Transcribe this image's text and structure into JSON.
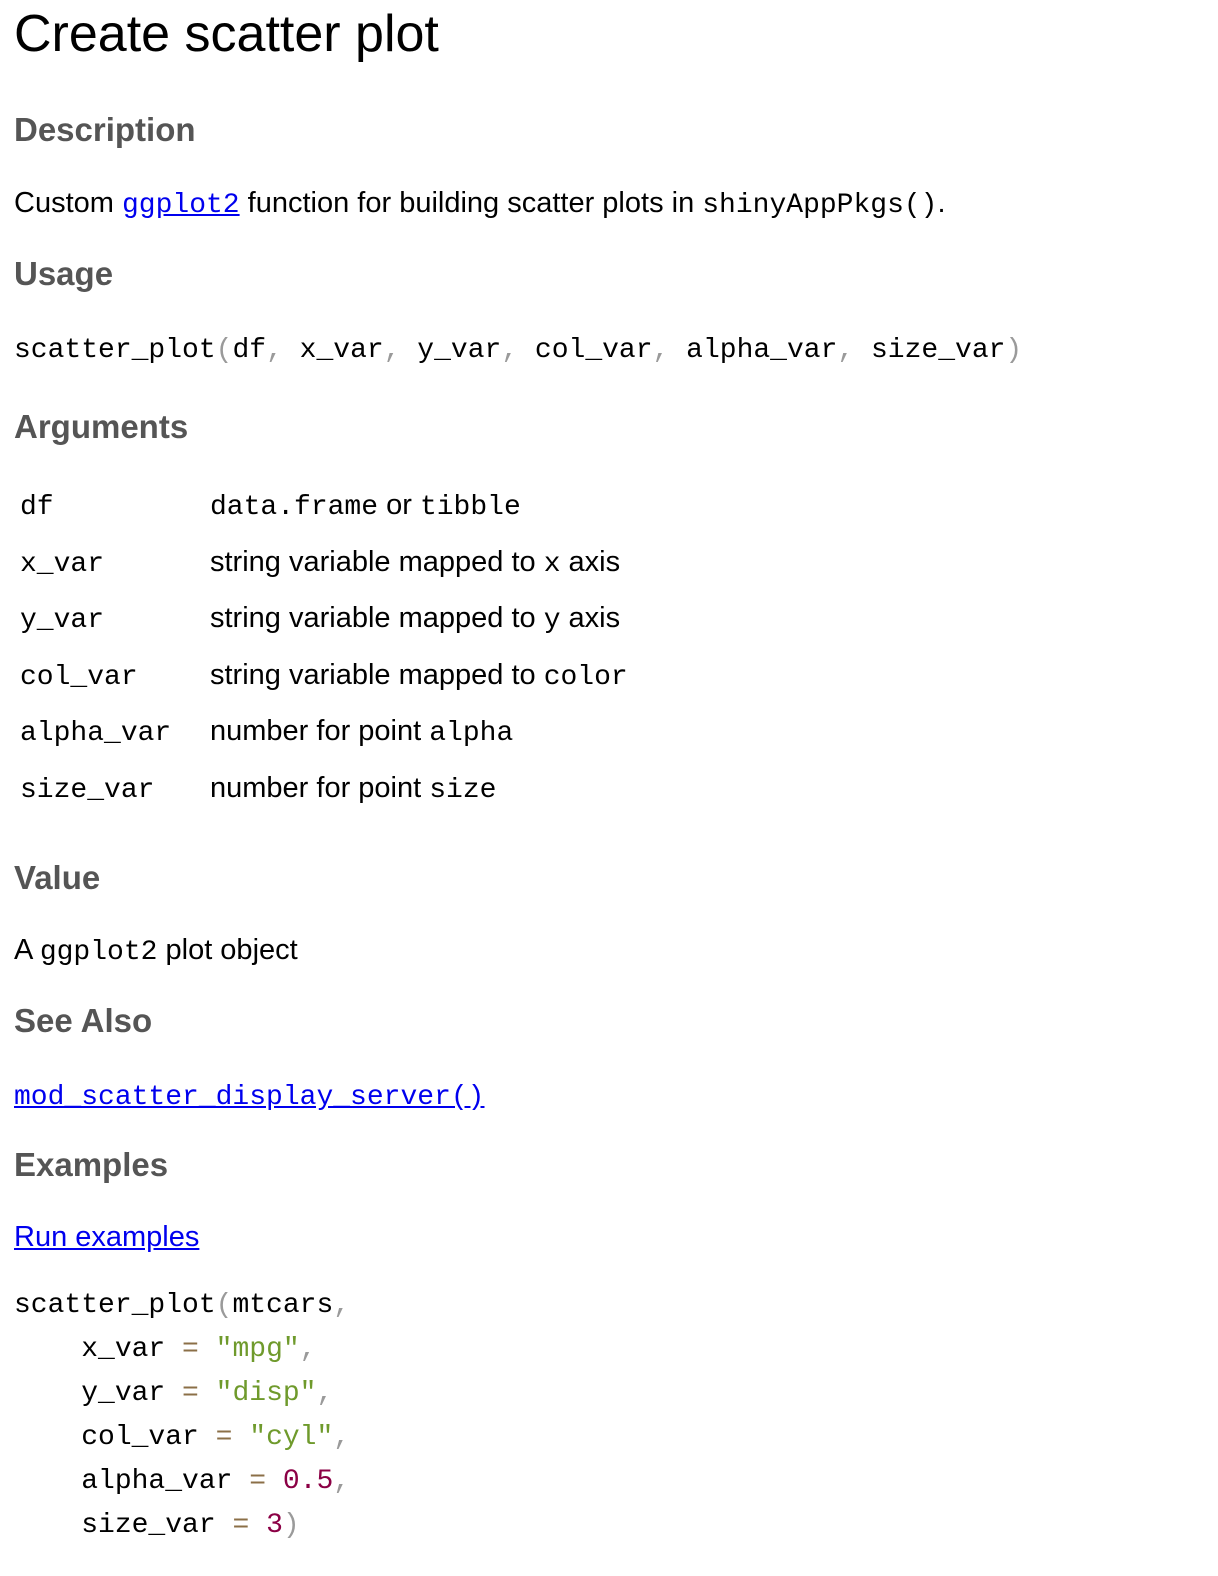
{
  "title": "Create scatter plot",
  "description": {
    "heading": "Description",
    "text_prefix": "Custom ",
    "link": "ggplot2",
    "text_middle": " function for building scatter plots in ",
    "code": "shinyAppPkgs()",
    "text_suffix": "."
  },
  "usage": {
    "heading": "Usage",
    "fn": "scatter_plot",
    "params": [
      "df",
      "x_var",
      "y_var",
      "col_var",
      "alpha_var",
      "size_var"
    ]
  },
  "arguments": {
    "heading": "Arguments",
    "rows": [
      {
        "name": "df",
        "desc": [
          {
            "t": "data.frame",
            "code": true
          },
          {
            "t": " or ",
            "code": false
          },
          {
            "t": "tibble",
            "code": true
          }
        ]
      },
      {
        "name": "x_var",
        "desc": [
          {
            "t": "string variable mapped to ",
            "code": false
          },
          {
            "t": "x",
            "code": true
          },
          {
            "t": " axis",
            "code": false
          }
        ]
      },
      {
        "name": "y_var",
        "desc": [
          {
            "t": "string variable mapped to ",
            "code": false
          },
          {
            "t": "y",
            "code": true
          },
          {
            "t": " axis",
            "code": false
          }
        ]
      },
      {
        "name": "col_var",
        "desc": [
          {
            "t": "string variable mapped to ",
            "code": false
          },
          {
            "t": "color",
            "code": true
          }
        ]
      },
      {
        "name": "alpha_var",
        "desc": [
          {
            "t": "number for point ",
            "code": false
          },
          {
            "t": "alpha",
            "code": true
          }
        ]
      },
      {
        "name": "size_var",
        "desc": [
          {
            "t": "number for point ",
            "code": false
          },
          {
            "t": "size",
            "code": true
          }
        ]
      }
    ]
  },
  "value": {
    "heading": "Value",
    "text_prefix": "A ",
    "code": "ggplot2",
    "text_suffix": " plot object"
  },
  "see_also": {
    "heading": "See Also",
    "link": "mod_scatter_display_server()"
  },
  "examples": {
    "heading": "Examples",
    "run_link": "Run examples",
    "fn": "scatter_plot",
    "first_arg": "mtcars",
    "args": [
      {
        "name": "x_var",
        "pad": " ",
        "value": "\"mpg\"",
        "kind": "str",
        "end": ","
      },
      {
        "name": "y_var",
        "pad": " ",
        "value": "\"disp\"",
        "kind": "str",
        "end": ","
      },
      {
        "name": "col_var",
        "pad": " ",
        "value": "\"cyl\"",
        "kind": "str",
        "end": ","
      },
      {
        "name": "alpha_var",
        "pad": " ",
        "value": "0.5",
        "kind": "num",
        "end": ","
      },
      {
        "name": "size_var",
        "pad": " ",
        "value": "3",
        "kind": "num",
        "end": ")"
      }
    ]
  }
}
